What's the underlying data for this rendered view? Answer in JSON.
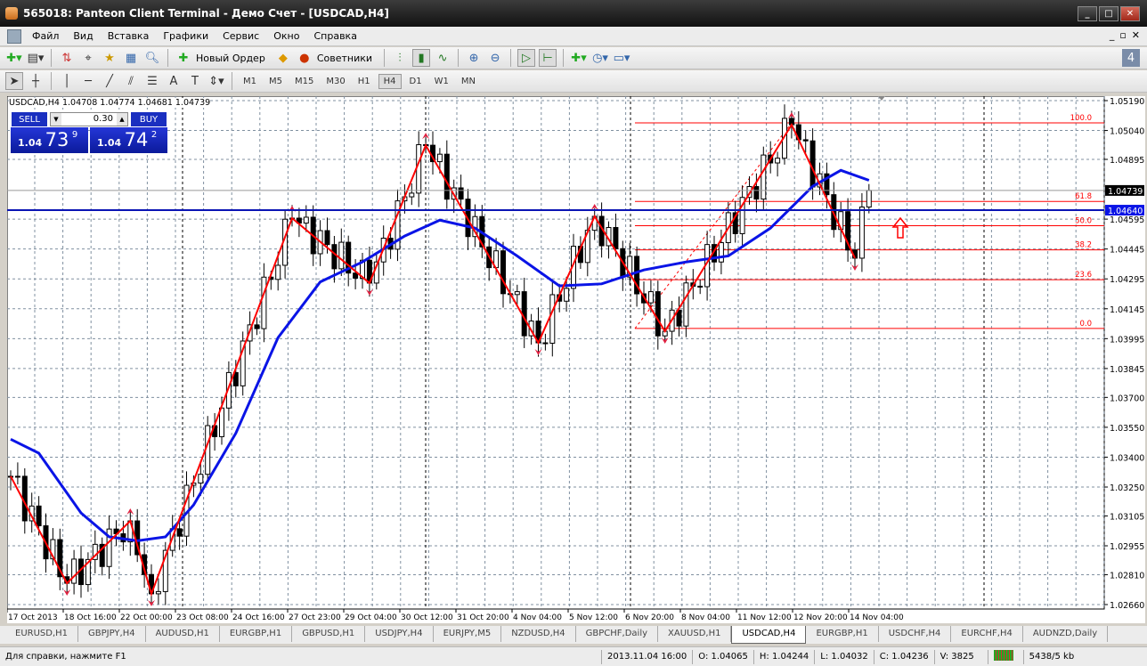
{
  "window": {
    "title": "565018: Panteon Client Terminal - Демо Счет - [USDCAD,H4]",
    "buttons": [
      "_",
      "□",
      "✕"
    ]
  },
  "menu": {
    "items": [
      "Файл",
      "Вид",
      "Вставка",
      "Графики",
      "Сервис",
      "Окно",
      "Справка"
    ],
    "mdi": [
      "_",
      "▫",
      "✕"
    ]
  },
  "toolbar": {
    "new_order": "Новый Ордер",
    "experts": "Советники"
  },
  "timeframes": [
    "M1",
    "M5",
    "M15",
    "M30",
    "H1",
    "H4",
    "D1",
    "W1",
    "MN"
  ],
  "active_tf": "H4",
  "chart": {
    "ohlc_line": "USDCAD,H4  1.04708 1.04774 1.04681 1.04739",
    "trade": {
      "sell": "SELL",
      "buy": "BUY",
      "lot": "0.30",
      "bid_prefix": "1.04",
      "bid_big": "73",
      "bid_pip": "9",
      "ask_prefix": "1.04",
      "ask_big": "74",
      "ask_pip": "2"
    },
    "price_ticks": [
      "1.05190",
      "1.05040",
      "1.04895",
      "1.04595",
      "1.04445",
      "1.04295",
      "1.04145",
      "1.03995",
      "1.03845",
      "1.03700",
      "1.03550",
      "1.03400",
      "1.03250",
      "1.03105",
      "1.02955",
      "1.02810",
      "1.02660"
    ],
    "price_range": [
      1.0266,
      1.0519
    ],
    "current_price": "1.04739",
    "hline_price": "1.04640",
    "time_labels": [
      "17 Oct 2013",
      "18 Oct 16:00",
      "22 Oct 00:00",
      "23 Oct 08:00",
      "24 Oct 16:00",
      "27 Oct 23:00",
      "29 Oct 04:00",
      "30 Oct 12:00",
      "31 Oct 20:00",
      "4 Nov 04:00",
      "5 Nov 12:00",
      "6 Nov 20:00",
      "8 Nov 04:00",
      "11 Nov 12:00",
      "12 Nov 20:00",
      "14 Nov 04:00"
    ],
    "zigzag": [
      [
        0,
        1.03304
      ],
      [
        8,
        1.02767
      ],
      [
        17,
        1.0308
      ],
      [
        20,
        1.02714
      ],
      [
        40,
        1.046
      ],
      [
        51,
        1.04274
      ],
      [
        59,
        1.04966
      ],
      [
        75,
        1.03974
      ],
      [
        83,
        1.04609
      ],
      [
        93,
        1.04032
      ],
      [
        111,
        1.05069
      ],
      [
        120,
        1.04399
      ],
      [
        122,
        1.04739
      ]
    ],
    "moving_average": [
      [
        0,
        1.0349
      ],
      [
        4,
        1.0342
      ],
      [
        10,
        1.0312
      ],
      [
        14,
        1.03
      ],
      [
        18,
        1.0298
      ],
      [
        22,
        1.03
      ],
      [
        26,
        1.0316
      ],
      [
        32,
        1.0352
      ],
      [
        38,
        1.04
      ],
      [
        44,
        1.0428
      ],
      [
        50,
        1.0438
      ],
      [
        56,
        1.0451
      ],
      [
        61,
        1.0459
      ],
      [
        66,
        1.0455
      ],
      [
        72,
        1.0441
      ],
      [
        78,
        1.0426
      ],
      [
        84,
        1.0427
      ],
      [
        90,
        1.0434
      ],
      [
        96,
        1.0438
      ],
      [
        102,
        1.0441
      ],
      [
        108,
        1.0455
      ],
      [
        114,
        1.0476
      ],
      [
        118,
        1.0484
      ],
      [
        122,
        1.0479
      ]
    ],
    "fibo": {
      "levels": [
        {
          "label": "100.0",
          "price": 1.05078
        },
        {
          "label": "61.8",
          "price": 1.04684
        },
        {
          "label": "50.0",
          "price": 1.04562
        },
        {
          "label": "38.2",
          "price": 1.04441
        },
        {
          "label": "23.6",
          "price": 1.04291
        },
        {
          "label": "0.0",
          "price": 1.04046
        }
      ]
    },
    "colors": {
      "zigzag": "#ff0000",
      "ma": "#0a14e6",
      "hline": "#0a14b4",
      "bull": "#ffffff",
      "bear": "#000000"
    }
  },
  "tabs": [
    "EURUSD,H1",
    "GBPJPY,H4",
    "AUDUSD,H1",
    "EURGBP,H1",
    "GBPUSD,H1",
    "USDJPY,H4",
    "EURJPY,M5",
    "NZDUSD,H4",
    "GBPCHF,Daily",
    "XAUUSD,H1",
    "USDCAD,H4",
    "EURGBP,H1",
    "USDCHF,H4",
    "EURCHF,H4",
    "AUDNZD,Daily"
  ],
  "active_tab": "USDCAD,H4",
  "status": {
    "help": "Для справки, нажмите F1",
    "time": "2013.11.04 16:00",
    "open": "O: 1.04065",
    "high": "H: 1.04244",
    "low": "L: 1.04032",
    "close": "C: 1.04236",
    "volume": "V: 3825",
    "traffic": "5438/5 kb"
  }
}
